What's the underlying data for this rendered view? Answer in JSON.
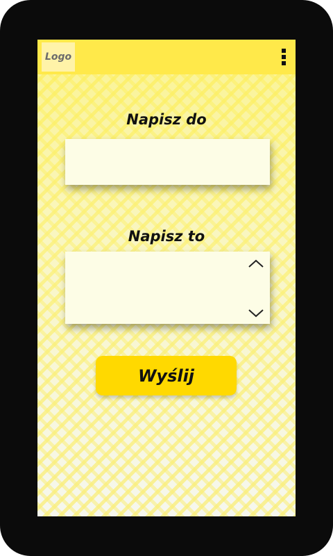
{
  "header": {
    "logo_text": "Logo",
    "menu_icon": "kebab-menu-icon"
  },
  "form": {
    "to_label": "Napisz do",
    "to_value": "",
    "message_label": "Napisz to",
    "message_value": "",
    "scroll_up_icon": "chevron-up-icon",
    "scroll_down_icon": "chevron-down-icon",
    "send_label": "Wyślij"
  },
  "colors": {
    "frame": "#0b0b0b",
    "topbar": "#ffe94a",
    "button": "#ffd900",
    "field": "#fdfde6"
  }
}
